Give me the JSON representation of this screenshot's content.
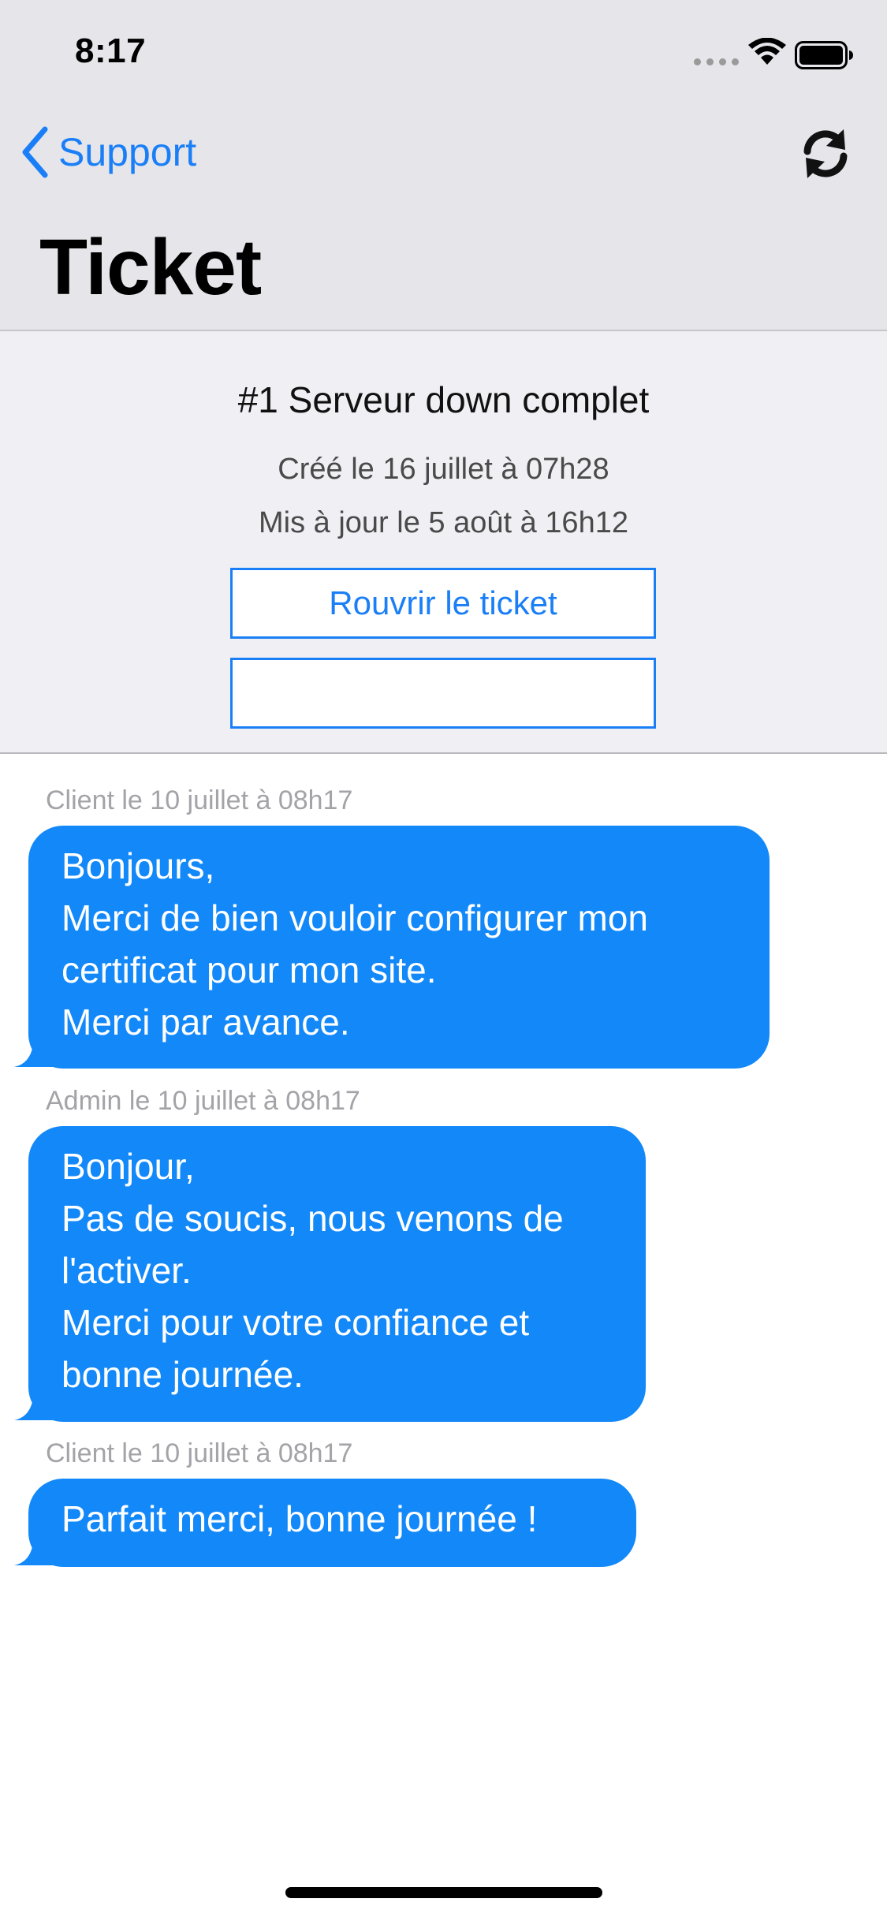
{
  "status_bar": {
    "time": "8:17"
  },
  "nav": {
    "back_label": "Support",
    "title": "Ticket",
    "back_icon": "chevron-left-icon",
    "refresh_icon": "refresh-icon"
  },
  "ticket": {
    "subject": "#1 Serveur down complet",
    "created": "Créé le 16 juillet à 07h28",
    "updated": "Mis à jour le 5 août à 16h12",
    "reopen_label": "Rouvrir le ticket",
    "second_button_label": ""
  },
  "messages": [
    {
      "meta": "Client le 10 juillet à 08h17",
      "text": "Bonjours,\nMerci de bien vouloir configurer mon certificat pour mon site.\nMerci par avance."
    },
    {
      "meta": "Admin le 10 juillet à 08h17",
      "text": "Bonjour,\nPas de soucis, nous venons de l'activer.\nMerci pour votre confiance et bonne journée."
    },
    {
      "meta": "Client le 10 juillet à 08h17",
      "text": "Parfait merci, bonne journée !"
    }
  ],
  "colors": {
    "accent": "#1a7ff7",
    "bubble": "#1288f9",
    "header_bg": "#e5e5ea",
    "panel_bg": "#efeff4"
  }
}
